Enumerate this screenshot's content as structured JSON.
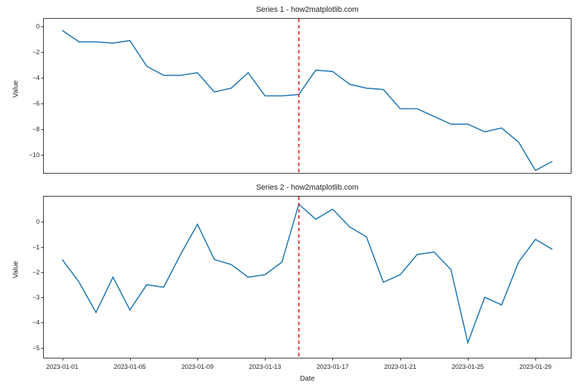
{
  "xlabel": "Date",
  "x_ticks": [
    "2023-01-01",
    "2023-01-05",
    "2023-01-09",
    "2023-01-13",
    "2023-01-17",
    "2023-01-21",
    "2023-01-25",
    "2023-01-29"
  ],
  "x_categories": [
    "2023-01-01",
    "2023-01-02",
    "2023-01-03",
    "2023-01-04",
    "2023-01-05",
    "2023-01-06",
    "2023-01-07",
    "2023-01-08",
    "2023-01-09",
    "2023-01-10",
    "2023-01-11",
    "2023-01-12",
    "2023-01-13",
    "2023-01-14",
    "2023-01-15",
    "2023-01-16",
    "2023-01-17",
    "2023-01-18",
    "2023-01-19",
    "2023-01-20",
    "2023-01-21",
    "2023-01-22",
    "2023-01-23",
    "2023-01-24",
    "2023-01-25",
    "2023-01-26",
    "2023-01-27",
    "2023-01-28",
    "2023-01-29",
    "2023-01-30"
  ],
  "vline_x": "2023-01-15",
  "vline_color": "#e31a1c",
  "line_color": "#1f77b4",
  "chart_data": [
    {
      "type": "line",
      "title": "Series 1 - how2matplotlib.com",
      "ylabel": "Value",
      "xlabel": "Date",
      "ylim": [
        -11.4,
        0.6
      ],
      "y_ticks": [
        0,
        -2,
        -4,
        -6,
        -8,
        -10
      ],
      "values": [
        -0.3,
        -1.2,
        -1.2,
        -1.3,
        -1.1,
        -3.1,
        -3.8,
        -3.8,
        -3.6,
        -5.1,
        -4.8,
        -3.6,
        -5.4,
        -5.4,
        -5.3,
        -3.4,
        -3.5,
        -4.5,
        -4.8,
        -4.9,
        -6.4,
        -6.4,
        -7.0,
        -7.6,
        -7.6,
        -8.2,
        -7.9,
        -9.0,
        -11.2,
        -10.5
      ]
    },
    {
      "type": "line",
      "title": "Series 2 - how2matplotlib.com",
      "ylabel": "Value",
      "xlabel": "Date",
      "ylim": [
        -5.4,
        1.0
      ],
      "y_ticks": [
        0,
        -1,
        -2,
        -3,
        -4,
        -5
      ],
      "values": [
        -1.5,
        -2.4,
        -3.6,
        -2.2,
        -3.5,
        -2.5,
        -2.6,
        -1.3,
        -0.1,
        -1.5,
        -1.7,
        -2.2,
        -2.1,
        -1.6,
        0.7,
        0.1,
        0.5,
        -0.2,
        -0.6,
        -2.4,
        -2.1,
        -1.3,
        -1.2,
        -1.9,
        -4.8,
        -3.0,
        -3.3,
        -1.6,
        -0.7,
        -1.1
      ]
    }
  ]
}
